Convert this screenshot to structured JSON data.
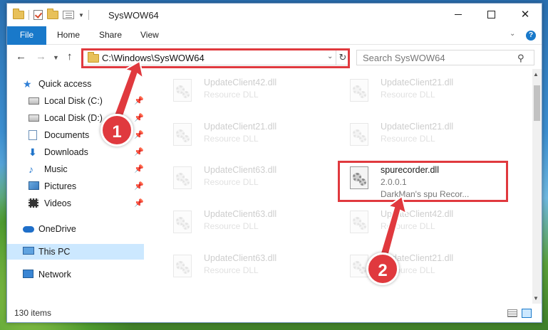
{
  "window": {
    "title": "SysWOW64",
    "controls": {
      "minimize": "",
      "maximize": "",
      "close": "✕"
    }
  },
  "ribbon": {
    "tabs": [
      "File",
      "Home",
      "Share",
      "View"
    ],
    "help": "?"
  },
  "navbar": {
    "address": "C:\\Windows\\SysWOW64",
    "search_placeholder": "Search SysWOW64"
  },
  "sidebar": {
    "items": [
      {
        "label": "Quick access",
        "icon": "star-icon",
        "pinned": false
      },
      {
        "label": "Local Disk (C:)",
        "icon": "disk-icon",
        "pinned": true
      },
      {
        "label": "Local Disk (D:)",
        "icon": "disk-icon",
        "pinned": true
      },
      {
        "label": "Documents",
        "icon": "documents-icon",
        "pinned": true
      },
      {
        "label": "Downloads",
        "icon": "downloads-icon",
        "pinned": true
      },
      {
        "label": "Music",
        "icon": "music-icon",
        "pinned": true
      },
      {
        "label": "Pictures",
        "icon": "pictures-icon",
        "pinned": true
      },
      {
        "label": "Videos",
        "icon": "videos-icon",
        "pinned": true
      },
      {
        "label": "OneDrive",
        "icon": "onedrive-icon",
        "pinned": false
      },
      {
        "label": "This PC",
        "icon": "this-pc-icon",
        "pinned": false,
        "selected": true
      },
      {
        "label": "Network",
        "icon": "network-icon",
        "pinned": false
      }
    ]
  },
  "files": [
    {
      "name": "UpdateClient42.dll",
      "type": "Resource DLL"
    },
    {
      "name": "UpdateClient21.dll",
      "type": "Resource DLL"
    },
    {
      "name": "UpdateClient21.dll",
      "type": "Resource DLL"
    },
    {
      "name": "UpdateClient21.dll",
      "type": "Resource DLL"
    },
    {
      "name": "UpdateClient63.dll",
      "type": "Resource DLL"
    },
    {
      "name": "spurecorder.dll",
      "type": "2.0.0.1",
      "desc": "DarkMan's spu Recor...",
      "highlighted": true
    },
    {
      "name": "UpdateClient63.dll",
      "type": "Resource DLL"
    },
    {
      "name": "UpdateClient42.dll",
      "type": "Resource DLL"
    },
    {
      "name": "UpdateClient63.dll",
      "type": "Resource DLL"
    },
    {
      "name": "UpdateClient21.dll",
      "type": "Resource DLL"
    }
  ],
  "status": {
    "item_count": "130 items"
  },
  "annotations": {
    "step1": "1",
    "step2": "2",
    "color": "#e0393e"
  }
}
